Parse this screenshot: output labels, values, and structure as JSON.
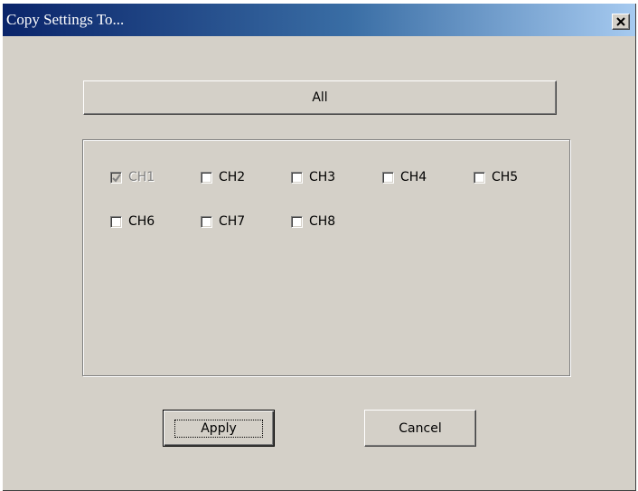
{
  "window": {
    "title": "Copy Settings To...",
    "close_glyph": "✕"
  },
  "buttons": {
    "all_label": "All",
    "apply_label": "Apply",
    "cancel_label": "Cancel"
  },
  "channels": [
    {
      "label": "CH1",
      "checked": true,
      "enabled": false
    },
    {
      "label": "CH2",
      "checked": false,
      "enabled": true
    },
    {
      "label": "CH3",
      "checked": false,
      "enabled": true
    },
    {
      "label": "CH4",
      "checked": false,
      "enabled": true
    },
    {
      "label": "CH5",
      "checked": false,
      "enabled": true
    },
    {
      "label": "CH6",
      "checked": false,
      "enabled": true
    },
    {
      "label": "CH7",
      "checked": false,
      "enabled": true
    },
    {
      "label": "CH8",
      "checked": false,
      "enabled": true
    }
  ],
  "colors": {
    "title_gradient_start": "#0a246a",
    "title_gradient_end": "#a6caf0",
    "dialog_face": "#d4d0c8"
  }
}
